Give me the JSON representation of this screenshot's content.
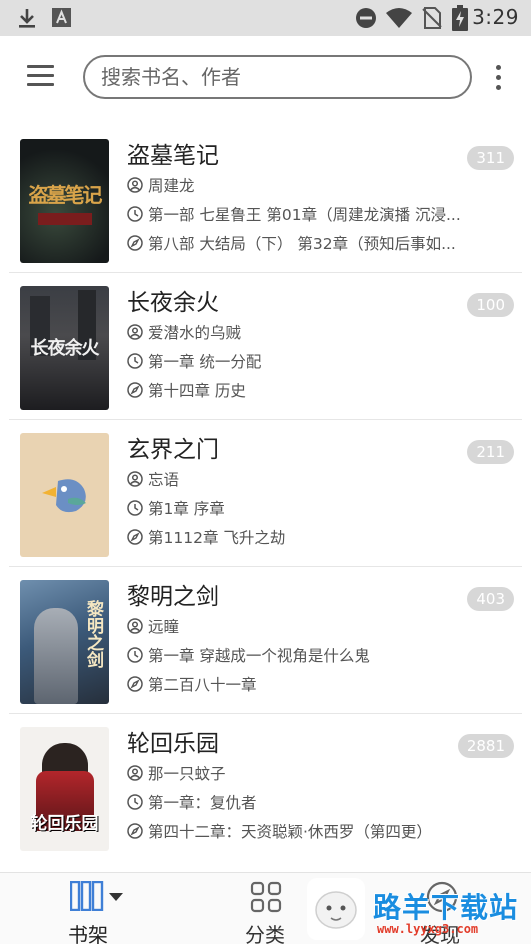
{
  "status_bar": {
    "time": "3:29",
    "left_icons": [
      "download-icon",
      "a-box-icon"
    ],
    "right_icons": [
      "do-not-disturb-icon",
      "wifi-icon",
      "no-sim-icon",
      "battery-charging-icon"
    ]
  },
  "app_bar": {
    "menu_icon": "menu-icon",
    "search_placeholder": "搜索书名、作者",
    "more_icon": "more-vert-icon"
  },
  "books": [
    {
      "title": "盗墓笔记",
      "unread": "311",
      "author": "周建龙",
      "last_read": "第一部 七星鲁王 第01章（周建龙演播 沉浸...",
      "latest": "第八部 大结局（下） 第32章（预知后事如...",
      "cover_text": "盗墓笔记",
      "cover_color": "#1c1f22"
    },
    {
      "title": "长夜余火",
      "unread": "100",
      "author": "爱潜水的乌贼",
      "last_read": "第一章 统一分配",
      "latest": "第十四章 历史",
      "cover_text": "长夜余火",
      "cover_color": "#2a2c30"
    },
    {
      "title": "玄界之门",
      "unread": "211",
      "author": "忘语",
      "last_read": "第1章 序章",
      "latest": "第1112章 飞升之劫",
      "cover_text": "",
      "cover_color": "#e9d3b2"
    },
    {
      "title": "黎明之剑",
      "unread": "403",
      "author": "远瞳",
      "last_read": "第一章 穿越成一个视角是什么鬼",
      "latest": "第二百八十一章",
      "cover_text": "黎明之剑",
      "cover_color": "#3c5a7a"
    },
    {
      "title": "轮回乐园",
      "unread": "2881",
      "author": "那一只蚊子",
      "last_read": "第一章：复仇者",
      "latest": "第四十二章：天资聪颖·休西罗（第四更）",
      "cover_text": "轮回乐园",
      "cover_color": "#f3f1ee"
    }
  ],
  "bottom_nav": {
    "shelf": "书架",
    "category": "分类",
    "discover": "发现"
  },
  "watermark": {
    "text": "路羊下载站",
    "url": "www.lyyxg3.com"
  },
  "colors": {
    "status_bar_bg": "#e0e0e0",
    "accent": "#3f7fd6",
    "badge_bg": "#d7d7d7"
  }
}
